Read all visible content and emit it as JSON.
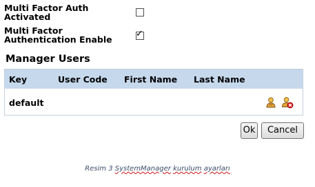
{
  "settings": {
    "mfa_activated": {
      "label_line1": "Multi Factor Auth",
      "label_line2": "Activated",
      "checked": false
    },
    "mfa_enable": {
      "label_line1": "Multi Factor",
      "label_line2": "Authentication Enable",
      "checked": true,
      "check_glyph": "✓"
    }
  },
  "manager_users": {
    "title": "Manager Users",
    "columns": [
      "Key",
      "User Code",
      "First Name",
      "Last Name"
    ],
    "rows": [
      {
        "key": "default",
        "user_code": "",
        "first_name": "",
        "last_name": "",
        "actions": [
          "edit-user-icon",
          "delete-user-icon"
        ]
      }
    ]
  },
  "buttons": {
    "ok_label": "Ok",
    "cancel_label": "Cancel"
  },
  "caption": {
    "part1": "Resim 3 ",
    "part2": "SystemManager",
    "part3": " ",
    "part4": "kurulum",
    "part5": " ",
    "part6": "ayarları"
  },
  "colors": {
    "table_header_bg": "#c6d8ec",
    "table_border": "#c5cfdb",
    "caption_text": "#3a4a68",
    "spellcheck_underline": "#d01010"
  }
}
